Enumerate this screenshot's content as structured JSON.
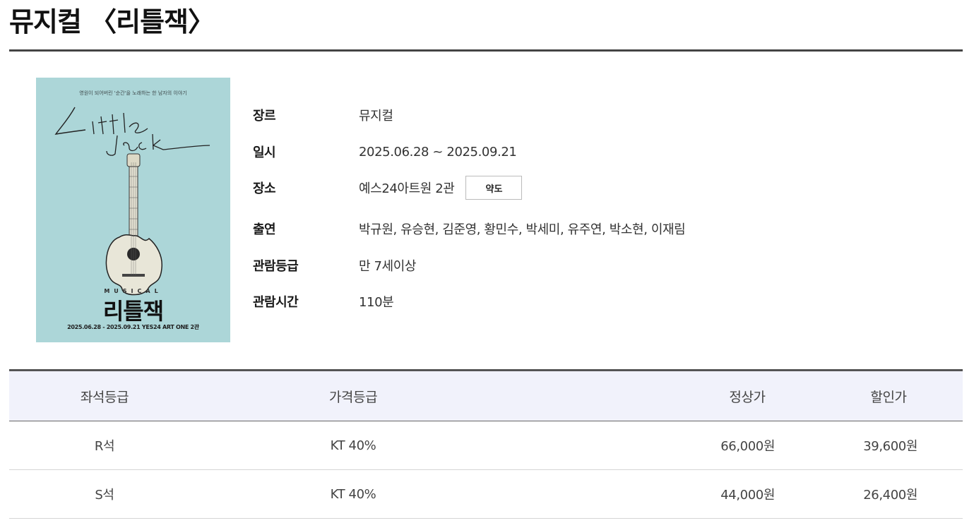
{
  "page": {
    "title": "뮤지컬 〈리틀잭〉"
  },
  "poster": {
    "tagline": "영원이 되어버린 '순간'을 노래하는 한 남자의 이야기",
    "script_title": "Little Jack",
    "musical_label": "MUSICAL",
    "title": "리틀잭",
    "footer": "2025.06.28 - 2025.09.21 YES24 ART ONE 2관",
    "background_color": "#acd6d8"
  },
  "info": {
    "rows": [
      {
        "label": "장르",
        "value": "뮤지컬"
      },
      {
        "label": "일시",
        "value": "2025.06.28 ~ 2025.09.21"
      },
      {
        "label": "장소",
        "value": "예스24아트원 2관"
      },
      {
        "label": "출연",
        "value": "박규원, 유승현, 김준영, 황민수, 박세미, 유주연, 박소현, 이재림"
      },
      {
        "label": "관람등급",
        "value": "만 7세이상"
      },
      {
        "label": "관람시간",
        "value": "110분"
      }
    ],
    "map_button_label": "약도"
  },
  "price_table": {
    "headers": {
      "seat": "좌석등급",
      "grade": "가격등급",
      "regular": "정상가",
      "discount": "할인가"
    },
    "rows": [
      {
        "seat": "R석",
        "grade": "KT 40%",
        "regular": "66,000원",
        "discount": "39,600원"
      },
      {
        "seat": "S석",
        "grade": "KT 40%",
        "regular": "44,000원",
        "discount": "26,400원"
      }
    ]
  },
  "colors": {
    "header_bg": "#f1f2fb",
    "rule": "#444444"
  }
}
